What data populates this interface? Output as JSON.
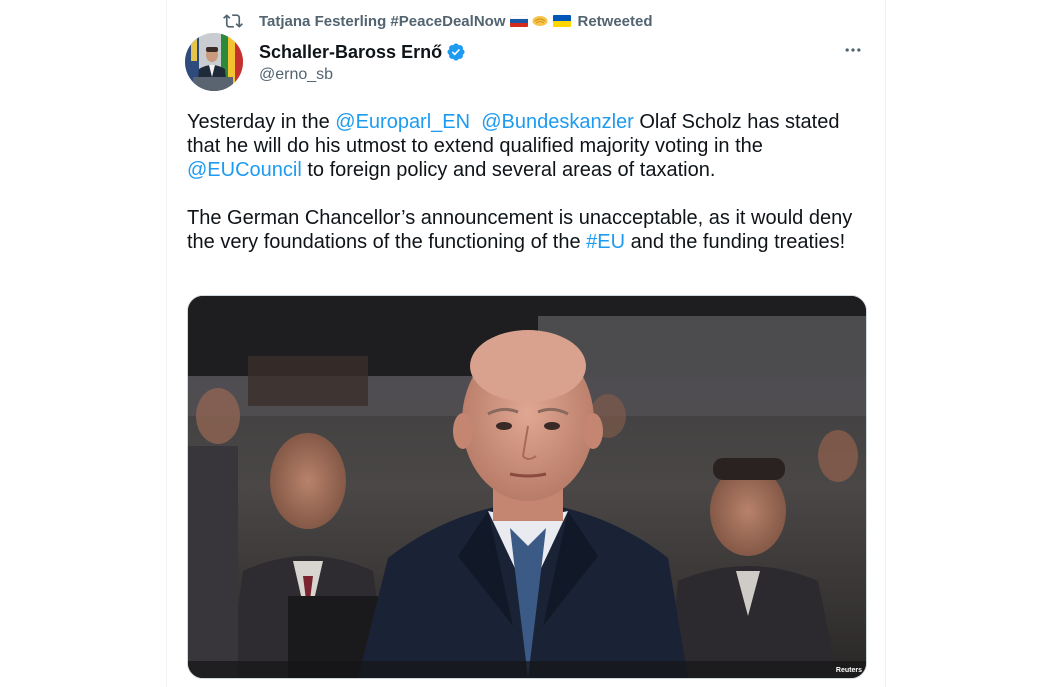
{
  "retweet": {
    "retweeter_name": "Tatjana Festerling #PeaceDealNow",
    "suffix": "Retweeted"
  },
  "author": {
    "display_name": "Schaller-Baross Ernő",
    "handle": "@erno_sb"
  },
  "tweet": {
    "paragraph1": {
      "t1": "Yesterday in the ",
      "m1": "@Europarl_EN",
      "t2": "  ",
      "m2": "@Bundeskanzler",
      "t3": " Olaf Scholz has stated that he will do his utmost to extend qualified majority voting in the ",
      "m3": "@EUCouncil",
      "t4": " to foreign policy and several areas of taxation."
    },
    "paragraph2": {
      "t1": "The German Chancellor’s announcement is unacceptable, as it would deny the very foundations of the functioning of the ",
      "h1": "#EU",
      "t2": " and the funding treaties!"
    }
  },
  "media": {
    "credit": "Reuters"
  },
  "colors": {
    "link": "#1d9bf0",
    "muted": "#536471",
    "text": "#0f1419",
    "verified": "#1d9bf0"
  },
  "icons": {
    "retweet": "retweet-icon",
    "verified": "verified-badge-icon",
    "more": "more-options-icon"
  }
}
